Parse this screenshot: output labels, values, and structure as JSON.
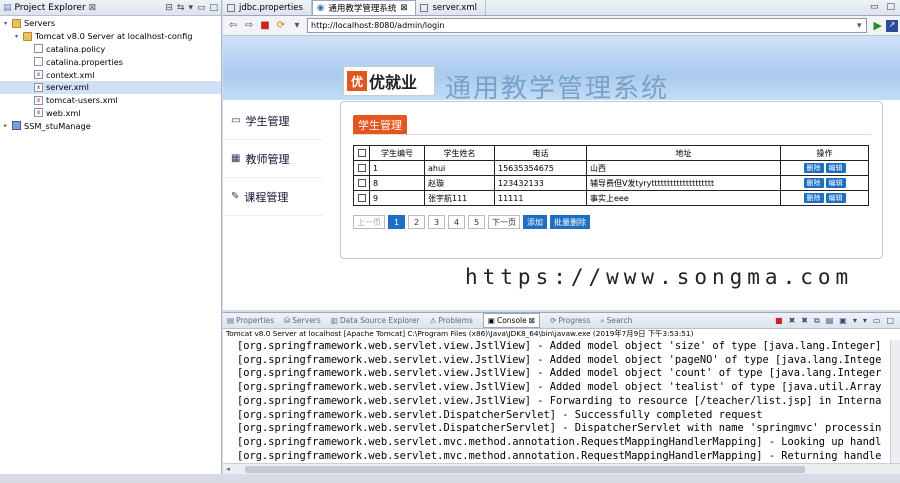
{
  "explorer": {
    "title": "Project Explorer",
    "close": "⊠",
    "tree": [
      {
        "label": "Servers",
        "level": 0,
        "icon": "folder-icon",
        "toggle": "▾"
      },
      {
        "label": "Tomcat v8.0 Server at localhost-config",
        "level": 1,
        "icon": "folder-icon",
        "toggle": "▾"
      },
      {
        "label": "catalina.policy",
        "level": 2,
        "icon": "file-icon",
        "toggle": ""
      },
      {
        "label": "catalina.properties",
        "level": 2,
        "icon": "file-icon",
        "toggle": ""
      },
      {
        "label": "context.xml",
        "level": 2,
        "icon": "xml-file-icon",
        "toggle": ""
      },
      {
        "label": "server.xml",
        "level": 2,
        "icon": "xml-file-icon",
        "toggle": "",
        "selected": true
      },
      {
        "label": "tomcat-users.xml",
        "level": 2,
        "icon": "xml-file-icon",
        "toggle": ""
      },
      {
        "label": "web.xml",
        "level": 2,
        "icon": "xml-file-icon",
        "toggle": ""
      },
      {
        "label": "SSM_stuManage",
        "level": 0,
        "icon": "project-icon",
        "toggle": "▸"
      }
    ]
  },
  "editor_tabs": [
    {
      "label": "jdbc.properties",
      "active": false
    },
    {
      "label": "通用教学管理系统",
      "active": true,
      "close": "⊠"
    },
    {
      "label": "server.xml",
      "active": false
    }
  ],
  "browser": {
    "url": "http://localhost:8080/admin/login",
    "back": "⇦",
    "forward": "⇨",
    "stop": "■",
    "refresh": "⟳",
    "go": "▶"
  },
  "webpage": {
    "logo_mark": "优",
    "logo_text": "优就业",
    "system_title": "通用教学管理系统",
    "nav": [
      {
        "label": "学生管理",
        "icon": "monitor-icon",
        "glyph": "▭"
      },
      {
        "label": "教师管理",
        "icon": "grid-icon",
        "glyph": "▦"
      },
      {
        "label": "课程管理",
        "icon": "edit-icon",
        "glyph": "✎"
      }
    ],
    "panel_title": "学生管理",
    "table": {
      "headers": [
        "学生编号",
        "学生姓名",
        "电话",
        "地址",
        "操作"
      ],
      "rows": [
        {
          "id": "1",
          "name": "ahui",
          "phone": "15635354675",
          "address": "山西"
        },
        {
          "id": "8",
          "name": "赵璇",
          "phone": "123432133",
          "address": "辅导费但V发tyrytttttttttttttttttttt"
        },
        {
          "id": "9",
          "name": "张宇航111",
          "phone": "11111",
          "address": "事实上eee"
        }
      ],
      "delete_label": "删除",
      "edit_label": "编辑"
    },
    "pager": {
      "prev": "上一页",
      "pages": [
        "1",
        "2",
        "3",
        "4",
        "5"
      ],
      "current": "1",
      "next": "下一页",
      "add": "添加",
      "batch_delete": "批量删除"
    },
    "watermark": "https://www.songma.com"
  },
  "bottom_tabs": [
    {
      "label": "Properties",
      "active": false
    },
    {
      "label": "Servers",
      "active": false
    },
    {
      "label": "Data Source Explorer",
      "active": false
    },
    {
      "label": "Problems",
      "active": false
    },
    {
      "label": "Console",
      "active": true,
      "close": "⊠"
    },
    {
      "label": "Progress",
      "active": false
    },
    {
      "label": "Search",
      "active": false
    }
  ],
  "console": {
    "status": "Tomcat v8.0 Server at localhost [Apache Tomcat] C:\\Program Files (x86)\\Java\\JDK8_64\\bin\\javaw.exe (2019年7月9日 下午3:53:51)",
    "lines": [
      "[org.springframework.web.servlet.view.JstlView] - Added model object 'size' of type [java.lang.Integer]",
      "[org.springframework.web.servlet.view.JstlView] - Added model object 'pageNO' of type [java.lang.Intege",
      "[org.springframework.web.servlet.view.JstlView] - Added model object 'count' of type [java.lang.Integer",
      "[org.springframework.web.servlet.view.JstlView] - Added model object 'tealist' of type [java.util.Array",
      "[org.springframework.web.servlet.view.JstlView] - Forwarding to resource [/teacher/list.jsp] in Interna",
      "[org.springframework.web.servlet.DispatcherServlet] - Successfully completed request",
      "[org.springframework.web.servlet.DispatcherServlet] - DispatcherServlet with name 'springmvc' processin",
      "[org.springframework.web.servlet.mvc.method.annotation.RequestMappingHandlerMapping] - Looking up handl",
      "[org.springframework.web.servlet.mvc.method.annotation.RequestMappingHandlerMapping] - Returning handle"
    ]
  },
  "colors": {
    "accent": "#e2571e",
    "button_blue": "#1e6ec3"
  }
}
